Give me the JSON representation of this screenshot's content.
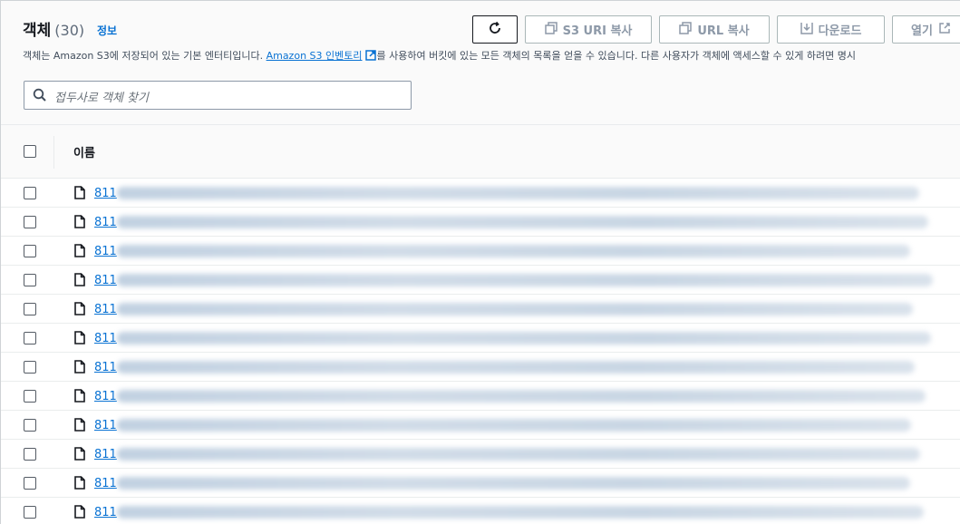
{
  "header": {
    "title": "객체",
    "count": "(30)",
    "info_link": "정보",
    "desc_before": "객체는 Amazon S3에 저장되어 있는 기본 엔터티입니다.",
    "desc_link": "Amazon S3 인벤토리",
    "desc_after": "를 사용하여 버킷에 있는 모든 객체의 목록을 얻을 수 있습니다. 다른 사용자가 객체에 액세스할 수 있게 하려면 명시"
  },
  "toolbar": {
    "refresh_icon": "refresh-icon",
    "copy_s3_uri": "S3 URI 복사",
    "copy_url": "URL 복사",
    "download": "다운로드",
    "open": "열기"
  },
  "search": {
    "placeholder": "접두사로 객체 찾기"
  },
  "table": {
    "column_name": "이름",
    "rows": [
      "811",
      "811",
      "811",
      "811",
      "811",
      "811",
      "811",
      "811",
      "811",
      "811",
      "811",
      "811"
    ]
  },
  "colors": {
    "link": "#0972d3",
    "text": "#16191f",
    "disabled": "#8d99a8"
  }
}
